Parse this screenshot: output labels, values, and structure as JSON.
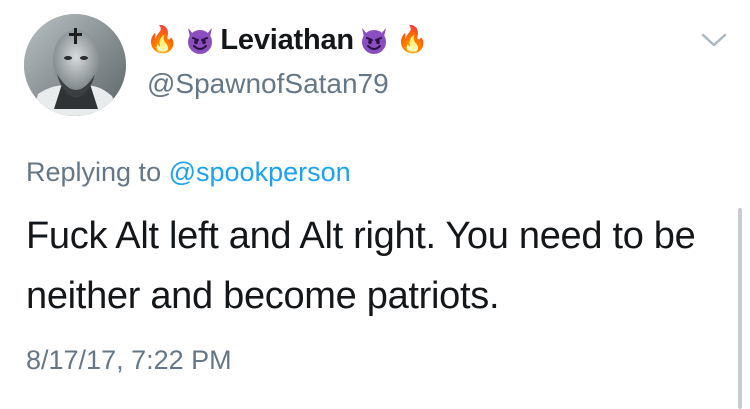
{
  "author": {
    "display_name": "Leviathan",
    "handle": "@SpawnofSatan79",
    "name_decorations": {
      "left": [
        "fire-emoji",
        "smiling-devil-emoji"
      ],
      "right": [
        "smiling-devil-emoji",
        "fire-emoji"
      ]
    },
    "avatar_icon": "avatar-photo"
  },
  "reply": {
    "prefix": "Replying to",
    "mention": "@spookperson"
  },
  "tweet": {
    "text": "Fuck Alt left and Alt right. You need to be neither and become patriots.",
    "timestamp": "8/17/17, 7:22 PM"
  },
  "menu_icon": "chevron-down-icon",
  "colors": {
    "text_primary": "#14171a",
    "text_secondary": "#657786",
    "link": "#1da1f2",
    "devil_purple": "#8a4ec0"
  }
}
